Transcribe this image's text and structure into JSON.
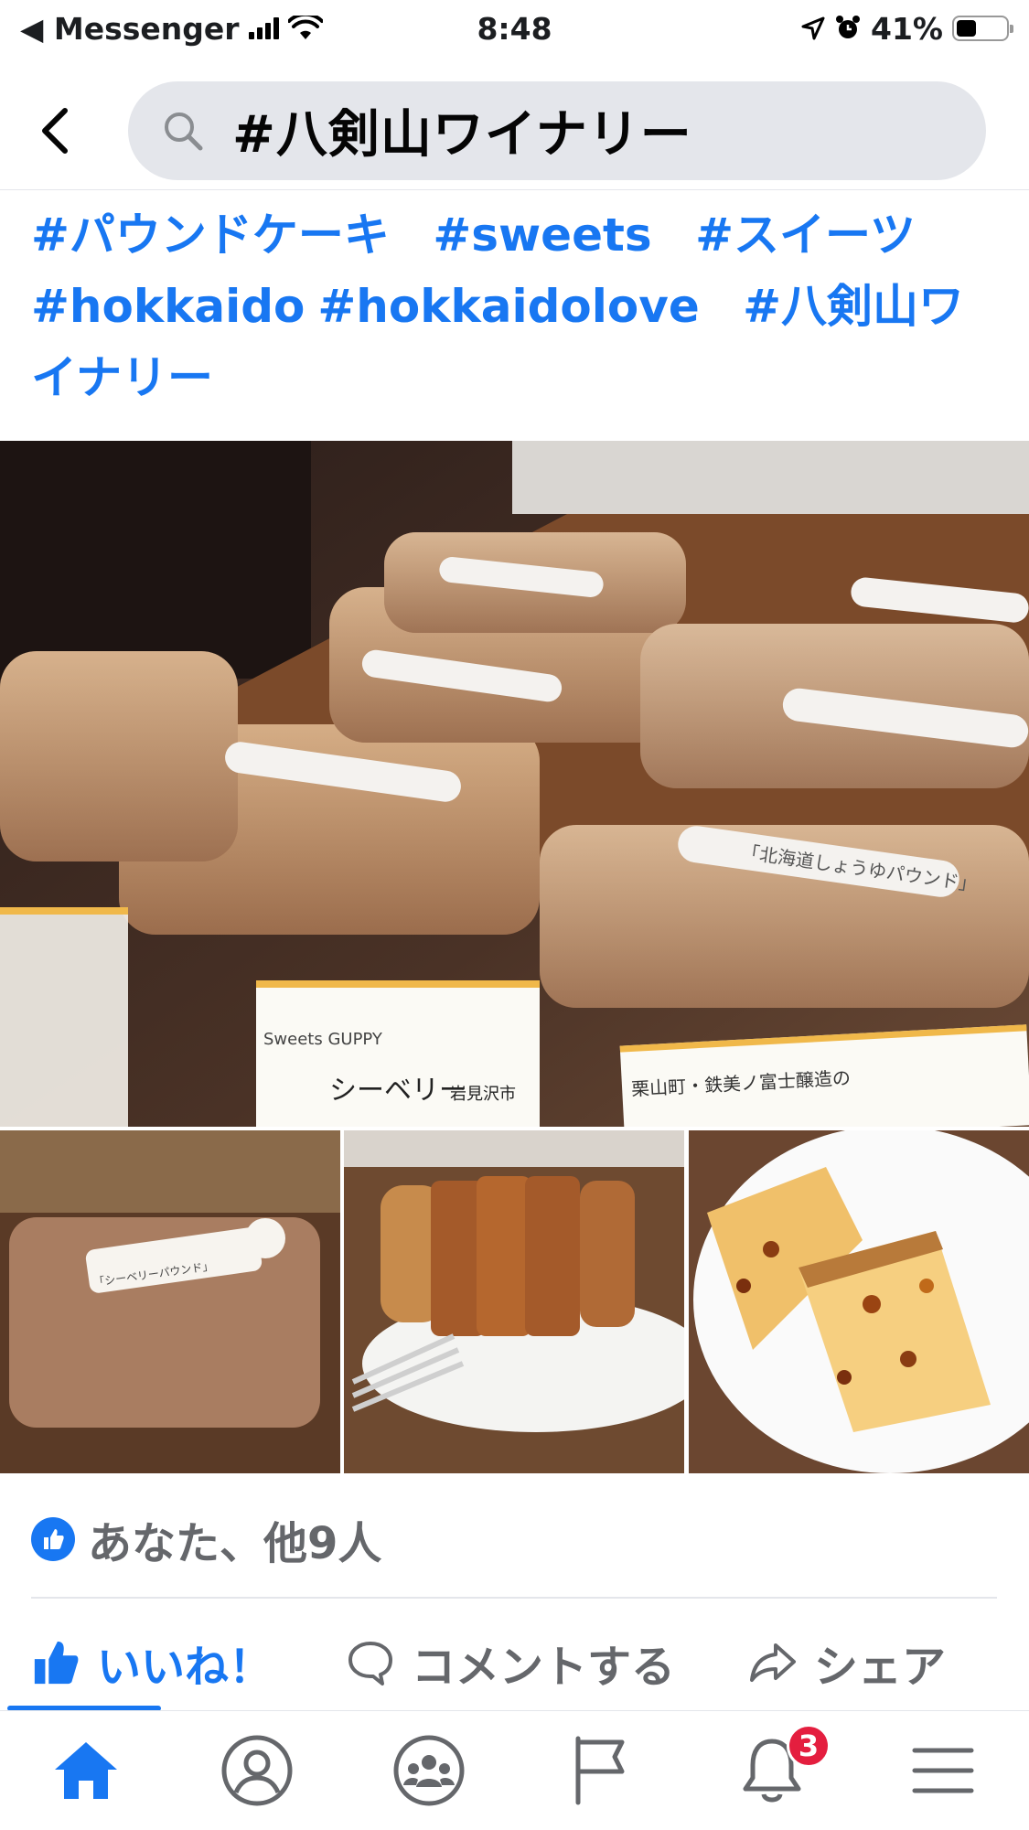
{
  "status_bar": {
    "back_app": "◀ Messenger",
    "time": "8:48",
    "battery": "41%",
    "battery_level": 0.41
  },
  "search": {
    "query": "#八剣山ワイナリー"
  },
  "post": {
    "hashtags": [
      "#パウンドケーキ",
      "#sweets",
      "#スイーツ",
      "#hokkaido",
      "#hokkaidolove",
      "#八剣山ワイナリー"
    ],
    "photo_labels": {
      "label_1": "シーベリー",
      "label_2": "岩見沢市",
      "label_3": "Sweets GUPPY",
      "label_4": "「北海道しょうゆパウンド」",
      "label_5": "栗山町・鉄美ノ富士醸造の",
      "label_6": "「シーベリーパウンド」"
    },
    "reactions_text": "あなた、他9人",
    "actions": {
      "like": "いいね！",
      "comment": "コメントする",
      "share": "シェア"
    }
  },
  "tabbar": {
    "notifications_count": "3",
    "items": [
      "home-icon",
      "profile-icon",
      "groups-icon",
      "pages-flag-icon",
      "notifications-bell-icon",
      "menu-icon"
    ]
  },
  "colors": {
    "accent": "#1877f2",
    "text_secondary": "#65676b",
    "search_bg": "#e4e6eb",
    "badge": "#e41e3f"
  }
}
